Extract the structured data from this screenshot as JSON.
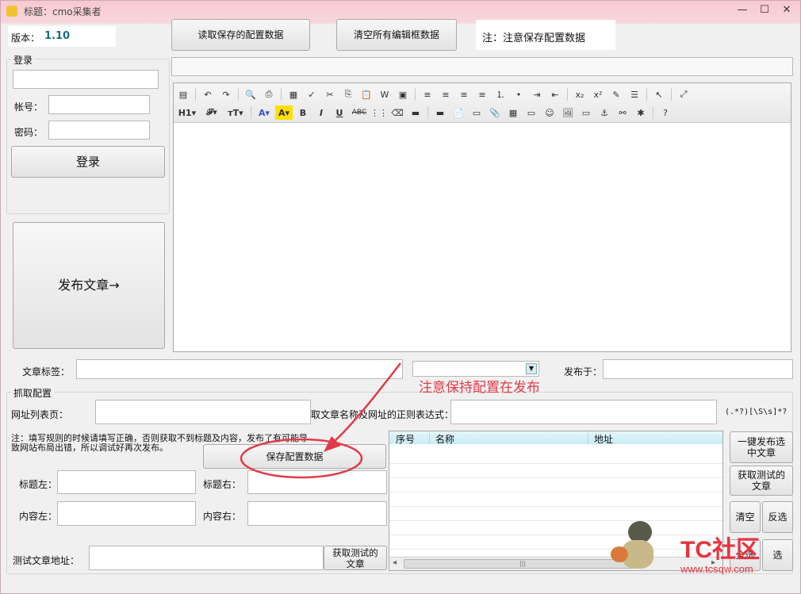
{
  "window": {
    "title": "标题：cmo采集者",
    "minimize_glyph": "—",
    "maximize_glyph": "☐",
    "close_glyph": "✕"
  },
  "header": {
    "version_label": "版本：",
    "version_value": "1.10",
    "read_config_button": "读取保存的配置数据",
    "clear_all_button": "清空所有编辑框数据",
    "notice": "注：注意保存配置数据"
  },
  "login": {
    "group_title": "登录",
    "account_label": "帐号：",
    "password_label": "密码：",
    "login_button": "登录"
  },
  "publish_button": "发布文章→",
  "editor": {
    "row1_icons": [
      "paste-icon",
      "undo-icon",
      "redo-icon",
      "preview-icon",
      "print-icon",
      "copy-format-icon",
      "clean-icon",
      "cut-icon",
      "copy-icon",
      "paste-text-icon",
      "paste-word-icon",
      "paste-html-icon",
      "align-left-icon",
      "align-center-icon",
      "align-right-icon",
      "justify-icon",
      "ordered-list-icon",
      "unordered-list-icon",
      "indent-icon",
      "outdent-icon",
      "subscript-icon",
      "superscript-icon",
      "clear-format-icon",
      "select-all-icon",
      "cursor-icon",
      "fullscreen-icon"
    ],
    "row1_glyphs": [
      "▤",
      "↶",
      "↷",
      "🔍",
      "⎙",
      "▦",
      "✓",
      "✂",
      "⎘",
      "📋",
      "W",
      "▣",
      "≡",
      "≡",
      "≡",
      "≡",
      "⒈",
      "•",
      "⇥",
      "⇤",
      "x₂",
      "x²",
      "✎",
      "☰",
      "↖",
      "⤢"
    ],
    "heading_label": "H1▾",
    "font_label": "𝓕▾",
    "size_label": "тT▾",
    "font_color_label": "A▾",
    "highlight_label": "A▾",
    "bold_label": "B",
    "italic_label": "I",
    "underline_label": "U",
    "strike_label": "ABC",
    "row2_glyphs": [
      "⋮⋮",
      "⌫",
      "▬",
      "▬",
      "📄",
      "▭",
      "📎",
      "▦",
      "▭",
      "☺",
      "🖼",
      "▭",
      "⚓",
      "⚯",
      "✱",
      "?"
    ],
    "row2_icons": [
      "table-icon",
      "eraser-icon",
      "insert-flash-icon",
      "insert-media-icon",
      "template-icon",
      "code-icon",
      "attach-icon",
      "grid-icon",
      "hr-icon",
      "emoticon-icon",
      "image-icon",
      "pagebreak-icon",
      "anchor-icon",
      "link-icon",
      "unlink-icon",
      "help-icon"
    ]
  },
  "tags": {
    "label": "文章标签：",
    "publish_at_label": "发布于："
  },
  "crawl": {
    "group_title": "抓取配置",
    "list_page_label": "网址列表页：",
    "regex_label": "取文章名称及网址的正则表达式：",
    "regex_hint": "(.*?)[\\S\\s]*?",
    "note_line1": "注：填写规则的时候请填写正确，否则获取不到标题及内容，发布了有可能导",
    "note_line2": "致网站布局出错，所以调试好再次发布。",
    "save_button": "保存配置数据",
    "title_left_label": "标题左：",
    "title_right_label": "标题右：",
    "content_left_label": "内容左：",
    "content_right_label": "内容右：",
    "test_url_label": "测试文章地址：",
    "get_test_button": "获取测试的文章"
  },
  "grid": {
    "columns": [
      "序号",
      "名称",
      "地址"
    ]
  },
  "actions": {
    "publish_selected": "一键发布选中文章",
    "get_test_article": "获取测试的文章",
    "clear": "清空",
    "invert": "反选",
    "select_all": "全选",
    "extra": "选"
  },
  "annotation": {
    "text": "注意保持配置在发布",
    "color": "#e23a48"
  },
  "watermark": {
    "brand": "TC社区",
    "url": "www.tcsqw.com"
  },
  "scrollbar": {
    "thumb_glyph": "|||",
    "left_glyph": "◂",
    "right_glyph": "▸"
  },
  "colors": {
    "accent_teal": "#1a6f7a",
    "title_pink": "#f9c8cf",
    "grid_header": "#c8ecf5"
  }
}
